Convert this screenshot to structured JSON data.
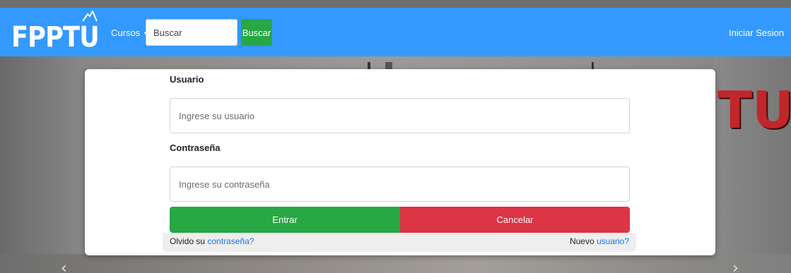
{
  "brand": {
    "logo_text": "FPPTU"
  },
  "nav": {
    "cursos_label": "Cursos",
    "search_placeholder": "Buscar",
    "search_button": "Buscar",
    "login_link": "Iniciar Sesion"
  },
  "carousel": {
    "prev_icon": "‹",
    "next_icon": "›",
    "bg_logo_text": "TU"
  },
  "login": {
    "user_label": "Usuario",
    "user_placeholder": "Ingrese su usuario",
    "pass_label": "Contraseña",
    "pass_placeholder": "Ingrese su contraseña",
    "enter_button": "Entrar",
    "cancel_button": "Cancelar",
    "forgot_prefix": "Olvido su",
    "forgot_link": "contraseña?",
    "new_prefix": "Nuevo",
    "new_link": "usuario?"
  },
  "colors": {
    "navbar": "#3399ff",
    "success": "#28a745",
    "danger": "#dc3545",
    "link": "#1a73e8"
  }
}
